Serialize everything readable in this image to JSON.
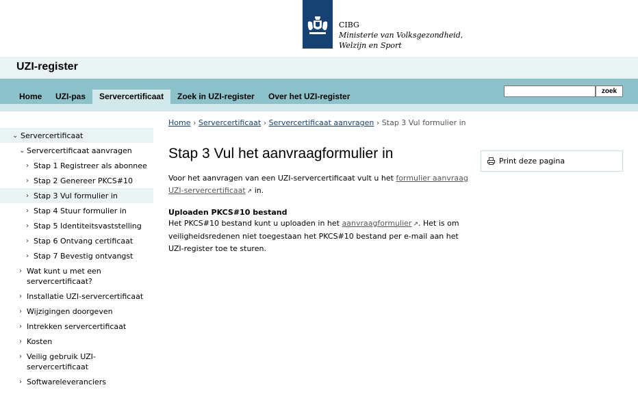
{
  "logo": {
    "line1": "CIBG",
    "line2": "Ministerie van Volksgezondheid,",
    "line3": "Welzijn en Sport"
  },
  "site_title": "UZI-register",
  "nav": {
    "items": [
      {
        "label": "Home"
      },
      {
        "label": "UZI-pas"
      },
      {
        "label": "Servercertificaat"
      },
      {
        "label": "Zoek in UZI-register"
      },
      {
        "label": "Over het UZI-register"
      }
    ],
    "active_index": 2,
    "search_value": "",
    "search_button": "zoek"
  },
  "sidebar": {
    "items": [
      {
        "label": "Servercertificaat",
        "level": 0,
        "expanded": true
      },
      {
        "label": "Servercertificaat aanvragen",
        "level": 1,
        "expanded": true
      },
      {
        "label": "Stap 1 Registreer als abonnee",
        "level": 2
      },
      {
        "label": "Stap 2 Genereer PKCS#10",
        "level": 2
      },
      {
        "label": "Stap 3 Vul formulier in",
        "level": 2,
        "active": true
      },
      {
        "label": "Stap 4 Stuur formulier in",
        "level": 2
      },
      {
        "label": "Stap 5 Identiteitsvaststelling",
        "level": 2
      },
      {
        "label": "Stap 6 Ontvang certificaat",
        "level": 2
      },
      {
        "label": "Stap 7 Bevestig ontvangst",
        "level": 2
      },
      {
        "label": "Wat kunt u met een servercertificaat?",
        "level": 1,
        "lines": [
          "Wat kunt u met een",
          "servercertificaat?"
        ]
      },
      {
        "label": "Installatie UZI-servercertificaat",
        "level": 1
      },
      {
        "label": "Wijzigingen doorgeven",
        "level": 1
      },
      {
        "label": "Intrekken servercertificaat",
        "level": 1
      },
      {
        "label": "Kosten",
        "level": 1
      },
      {
        "label": "Veilig gebruik UZI-servercertificaat",
        "level": 1,
        "lines": [
          "Veilig gebruik UZI-",
          "servercertificaat"
        ]
      },
      {
        "label": "Softwareleveranciers",
        "level": 1
      }
    ]
  },
  "breadcrumb": {
    "home": "Home",
    "servercertificaat": "Servercertificaat",
    "aanvragen": "Servercertificaat aanvragen",
    "current": "Stap 3 Vul formulier in"
  },
  "page_title": "Stap 3 Vul het aanvraagformulier in",
  "content": {
    "intro_before": "Voor het aanvragen van een UZI-servercertificaat vult u het",
    "intro_link": "formulier aanvraag UZI-servercertificaat",
    "intro_after": "in.",
    "upload_heading": "Uploaden PKCS#10 bestand",
    "upload_before": "Het PKCS#10 bestand kunt u uploaden in het",
    "upload_link": "aanvraagformulier",
    "upload_after": ". Het is om veiligheidsredenen niet toegestaan het PKCS#10 bestand per e-mail aan het UZI-register toe te sturen."
  },
  "print": {
    "label": "Print deze pagina",
    "icon": "printer-icon"
  },
  "colors": {
    "logo_blue": "#154273",
    "nav_band": "#8ec2cb",
    "title_band": "#e9f3f4",
    "active_tab": "#d3e8eb"
  }
}
